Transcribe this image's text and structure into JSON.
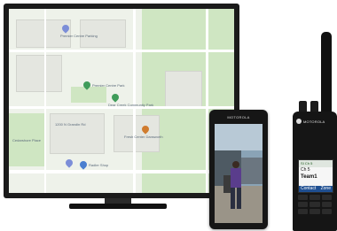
{
  "map": {
    "poi_labels": [
      "Premier Centre Parking",
      "Premier Centre Park",
      "Dear Creek Community Park",
      "Fresh Center Dansworth",
      "Cedarshore Place",
      "1200 N Grandin Rd",
      "Radler Shop"
    ]
  },
  "phone": {
    "brand": "MOTOROLA"
  },
  "radio": {
    "brand": "MOTOROLA",
    "status": "SI Ch 5",
    "zone": "Ch 5",
    "channel_name": "Team1",
    "softkey_left": "Contact",
    "softkey_right": "Zone"
  },
  "colors": {
    "radio_softkey_bar": "#1f4f91",
    "map_park": "#cfe6c2",
    "map_base": "#eef2ea"
  }
}
